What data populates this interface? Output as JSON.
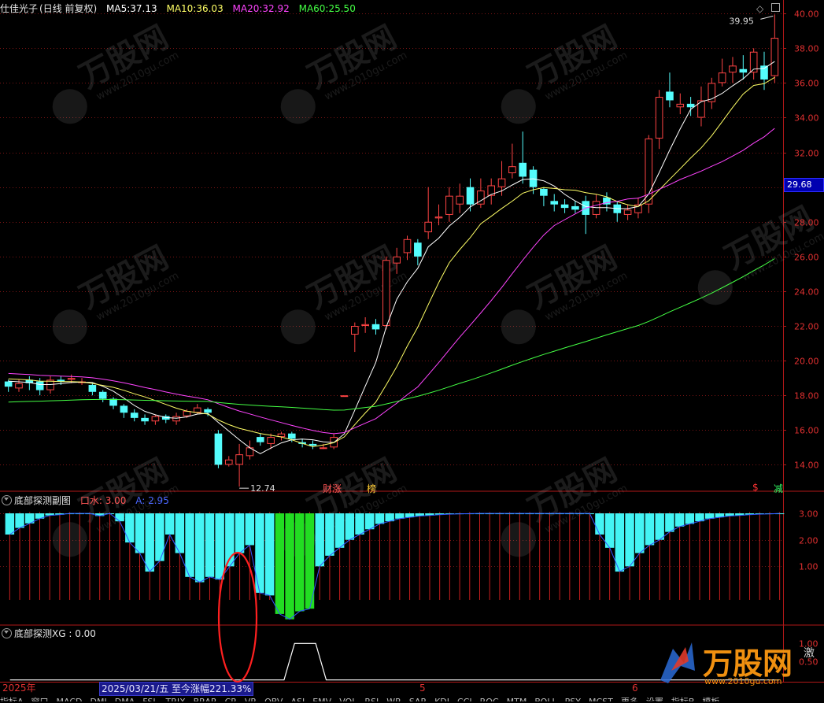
{
  "header": {
    "stock_name": "仕佳光子",
    "period": "(日线 前复权)",
    "ma5": {
      "label": "MA5:",
      "value": "37.13",
      "color": "#ffffff"
    },
    "ma10": {
      "label": "MA10:",
      "value": "36.03",
      "color": "#ffff66"
    },
    "ma20": {
      "label": "MA20:",
      "value": "32.92",
      "color": "#ff44ff"
    },
    "ma60": {
      "label": "MA60:",
      "value": "25.50",
      "color": "#44ff44"
    }
  },
  "price_axis": {
    "ticks": [
      "40.00",
      "38.00",
      "36.00",
      "34.00",
      "32.00",
      "30.00",
      "28.00",
      "26.00",
      "24.00",
      "22.00",
      "20.00",
      "18.00",
      "16.00",
      "14.00"
    ],
    "current_price": "29.68"
  },
  "annotations": {
    "high": "39.95",
    "low": "12.74",
    "event_caizhang": "财涨",
    "event_bang": "榜",
    "event_s": "$",
    "event_jian": "减"
  },
  "sub1": {
    "title": "底部探测副图",
    "legend_water": "口水: 3.00",
    "legend_a": "A: 2.95",
    "ticks": [
      "3.00",
      "2.00",
      "1.00"
    ]
  },
  "sub2": {
    "title": "底部探测XG : 0.00",
    "ticks": [
      "1.00",
      "0.50"
    ]
  },
  "time_axis": {
    "year": "2025年",
    "months": [
      "5",
      "6"
    ],
    "cursor_date": "2025/03/21/五  至今涨幅221.33%"
  },
  "tabs": [
    "指标A",
    "窗口",
    "MACD",
    "DMI",
    "DMA",
    "FSL",
    "TRIX",
    "BRAR",
    "CR",
    "VR",
    "OBV",
    "ASI",
    "EMV",
    "VOL",
    "RSI",
    "WR",
    "SAR",
    "KDJ",
    "CCI",
    "ROC",
    "MTM",
    "BOLL",
    "PSY",
    "MCST",
    "更多",
    "设置",
    "指标B",
    "模板"
  ],
  "watermark": {
    "brand": "万股网",
    "url": "www.2010gu.com",
    "side": "激"
  },
  "colors": {
    "up": "#ff4444",
    "down": "#54fcfc",
    "grid": "#7a1414",
    "axis": "#b01818"
  },
  "chart_data": [
    {
      "type": "candlestick",
      "title": "仕佳光子",
      "ylim": [
        13.2,
        40.6
      ],
      "series": [
        {
          "name": "K线",
          "ohlc": [
            [
              18.8,
              18.5,
              18.9,
              18.2
            ],
            [
              18.4,
              18.7,
              18.9,
              18.2
            ],
            [
              18.9,
              18.7,
              19.1,
              18.3
            ],
            [
              18.8,
              18.3,
              19.0,
              18.0
            ],
            [
              18.3,
              18.9,
              19.1,
              18.1
            ],
            [
              18.9,
              18.8,
              19.1,
              18.6
            ],
            [
              18.9,
              19.0,
              19.2,
              18.7
            ],
            [
              18.8,
              18.8,
              19.0,
              18.6
            ],
            [
              18.6,
              18.2,
              18.7,
              18.0
            ],
            [
              18.2,
              17.8,
              18.3,
              17.6
            ],
            [
              17.8,
              17.4,
              17.9,
              17.2
            ],
            [
              17.4,
              17.0,
              17.5,
              16.7
            ],
            [
              17.0,
              16.7,
              17.2,
              16.5
            ],
            [
              16.7,
              16.5,
              16.9,
              16.3
            ],
            [
              16.5,
              16.8,
              16.9,
              16.3
            ],
            [
              16.8,
              16.6,
              16.9,
              16.4
            ],
            [
              16.5,
              16.8,
              17.0,
              16.3
            ],
            [
              16.8,
              17.1,
              17.2,
              16.7
            ],
            [
              17.0,
              17.3,
              17.5,
              16.9
            ],
            [
              17.2,
              17.0,
              17.3,
              16.8
            ],
            [
              15.8,
              14.0,
              16.0,
              13.8
            ],
            [
              14.0,
              14.3,
              14.5,
              13.9
            ],
            [
              14.0,
              14.6,
              15.2,
              12.74
            ],
            [
              14.5,
              15.0,
              15.4,
              14.3
            ],
            [
              15.6,
              15.3,
              15.8,
              15.1
            ],
            [
              15.2,
              15.6,
              15.8,
              14.9
            ],
            [
              15.6,
              15.8,
              15.9,
              15.4
            ],
            [
              15.8,
              15.5,
              15.9,
              15.3
            ],
            [
              15.3,
              15.2,
              15.5,
              15.0
            ],
            [
              15.2,
              15.1,
              15.4,
              14.9
            ],
            [
              15.0,
              15.0,
              15.2,
              14.9
            ],
            [
              15.0,
              15.6,
              15.8,
              14.9
            ],
            [
              18.0,
              18.0,
              18.0,
              18.0
            ],
            [
              21.5,
              22.0,
              22.2,
              20.5
            ],
            [
              22.0,
              22.1,
              22.5,
              21.6
            ],
            [
              22.1,
              21.8,
              22.4,
              21.5
            ],
            [
              22.0,
              25.8,
              26.0,
              21.8
            ],
            [
              25.6,
              26.0,
              26.5,
              25.0
            ],
            [
              26.2,
              27.0,
              27.2,
              25.8
            ],
            [
              26.8,
              26.0,
              27.0,
              25.5
            ],
            [
              27.4,
              28.0,
              30.0,
              27.0
            ],
            [
              28.2,
              28.3,
              29.0,
              27.8
            ],
            [
              28.4,
              29.5,
              30.0,
              28.0
            ],
            [
              29.0,
              29.5,
              30.2,
              28.5
            ],
            [
              30.0,
              29.0,
              30.5,
              28.6
            ],
            [
              29.0,
              29.8,
              30.5,
              28.8
            ],
            [
              29.5,
              30.1,
              30.5,
              29.0
            ],
            [
              30.0,
              30.5,
              31.5,
              29.5
            ],
            [
              30.8,
              31.2,
              32.5,
              30.5
            ],
            [
              31.4,
              30.6,
              33.2,
              30.2
            ],
            [
              31.0,
              30.0,
              31.2,
              29.6
            ],
            [
              29.9,
              29.5,
              30.0,
              28.9
            ],
            [
              29.2,
              29.0,
              29.6,
              28.6
            ],
            [
              29.0,
              28.8,
              29.3,
              28.5
            ],
            [
              28.9,
              28.7,
              29.2,
              28.5
            ],
            [
              29.2,
              28.4,
              29.5,
              27.3
            ],
            [
              28.4,
              29.2,
              29.6,
              28.2
            ],
            [
              29.4,
              29.0,
              29.7,
              28.6
            ],
            [
              29.0,
              28.5,
              29.2,
              28.0
            ],
            [
              28.4,
              28.7,
              29.0,
              28.1
            ],
            [
              28.5,
              29.0,
              29.4,
              28.2
            ],
            [
              29.0,
              32.8,
              33.0,
              28.5
            ],
            [
              32.8,
              35.2,
              35.6,
              32.2
            ],
            [
              35.5,
              35.0,
              36.6,
              34.6
            ],
            [
              34.6,
              34.8,
              35.4,
              34.2
            ],
            [
              34.8,
              34.6,
              35.2,
              34.1
            ],
            [
              34.0,
              35.0,
              35.8,
              33.5
            ],
            [
              34.9,
              36.0,
              36.3,
              34.5
            ],
            [
              36.0,
              36.6,
              37.4,
              35.8
            ],
            [
              36.6,
              37.0,
              37.5,
              36.0
            ],
            [
              36.8,
              36.6,
              37.6,
              36.2
            ],
            [
              36.6,
              37.8,
              38.0,
              36.2
            ],
            [
              37.0,
              36.2,
              37.8,
              35.6
            ],
            [
              36.4,
              38.6,
              39.95,
              36.0
            ]
          ]
        }
      ]
    },
    {
      "type": "bar",
      "title": "底部探测副图",
      "ylim": [
        -1.1,
        3.3
      ],
      "series": [
        {
          "name": "A",
          "values": [
            2.2,
            2.45,
            2.62,
            2.8,
            2.92,
            2.95,
            3.0,
            3.0,
            3.0,
            2.9,
            3.0,
            2.7,
            1.9,
            1.5,
            0.8,
            1.2,
            2.2,
            1.5,
            0.6,
            0.4,
            0.6,
            0.5,
            1.0,
            1.5,
            1.8,
            0.0,
            -0.1,
            -0.8,
            -1.0,
            -0.7,
            -0.6,
            1.0,
            1.4,
            1.7,
            2.0,
            2.2,
            2.4,
            2.6,
            2.7,
            2.8,
            2.85,
            2.9,
            2.92,
            2.95,
            2.97,
            2.98,
            2.99,
            3.0,
            3.0,
            3.0,
            3.0,
            3.0,
            3.0,
            3.0,
            3.0,
            3.0,
            3.0,
            3.0,
            3.0,
            2.2,
            1.7,
            0.8,
            1.0,
            1.5,
            1.8,
            2.0,
            2.3,
            2.5,
            2.6,
            2.7,
            2.8,
            2.85,
            2.9,
            2.92,
            2.95,
            2.97,
            2.98,
            3.0
          ]
        }
      ]
    },
    {
      "type": "line",
      "title": "底部探测XG",
      "ylim": [
        -0.05,
        1.2
      ],
      "series": [
        {
          "name": "XG",
          "values": [
            0,
            0,
            0,
            0,
            0,
            0,
            0,
            0,
            0,
            0,
            0,
            0,
            0,
            0,
            0,
            0,
            0,
            0,
            0,
            0,
            0,
            0,
            0,
            0,
            0,
            0,
            0,
            1,
            1,
            1,
            0,
            0,
            0,
            0,
            0,
            0,
            0,
            0,
            0,
            0,
            0,
            0,
            0,
            0,
            0,
            0,
            0,
            0,
            0,
            0,
            0,
            0,
            0,
            0,
            0,
            0,
            0,
            0,
            0,
            0,
            0,
            0,
            0,
            0,
            0,
            0,
            0,
            0,
            0,
            0,
            0,
            0,
            0,
            0
          ]
        }
      ]
    }
  ]
}
